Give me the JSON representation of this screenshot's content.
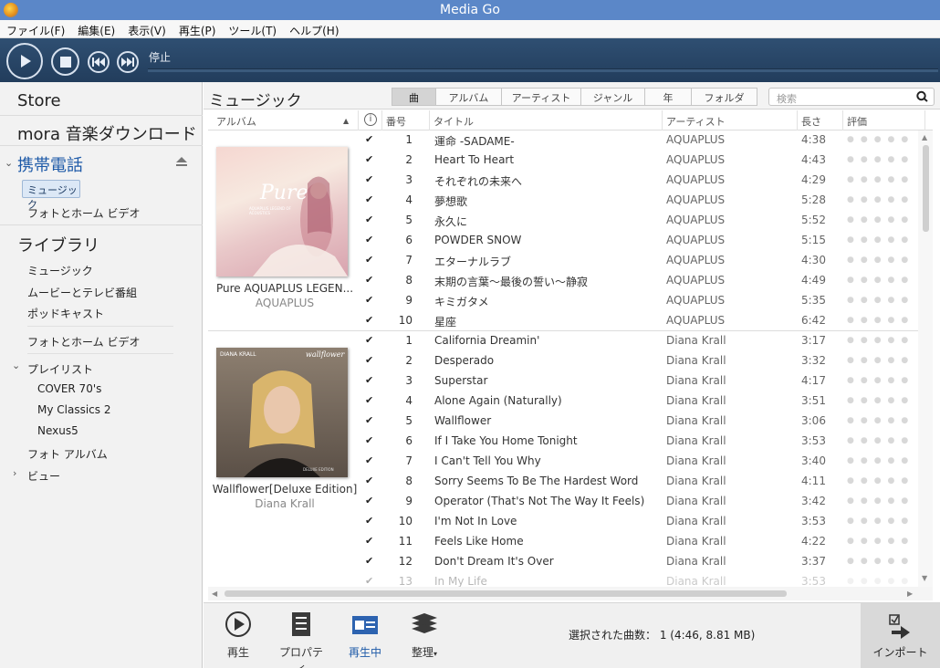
{
  "window": {
    "title": "Media Go"
  },
  "menu": [
    "ファイル(F)",
    "編集(E)",
    "表示(V)",
    "再生(P)",
    "ツール(T)",
    "ヘルプ(H)"
  ],
  "player": {
    "status": "停止"
  },
  "sidebar": {
    "store": "Store",
    "mora": "mora 音楽ダウンロード",
    "device": "携帯電話",
    "device_music": "ミュージック",
    "device_photo": "フォトとホーム ビデオ",
    "library": "ライブラリ",
    "lib_music": "ミュージック",
    "lib_movies": "ムービーとテレビ番組",
    "lib_podcast": "ポッドキャスト",
    "lib_photo": "フォトとホーム ビデオ",
    "playlist": "プレイリスト",
    "playlists": [
      "COVER 70's",
      "My Classics 2",
      "Nexus5"
    ],
    "photo_album": "フォト アルバム",
    "view": "ビュー"
  },
  "main": {
    "title": "ミュージック",
    "tabs": [
      "曲",
      "アルバム",
      "アーティスト",
      "ジャンル",
      "年",
      "フォルダ"
    ],
    "active_tab": "曲",
    "search_placeholder": "検索"
  },
  "columns": {
    "album": "アルバム",
    "info": "i",
    "num": "番号",
    "title": "タイトル",
    "artist": "アーティスト",
    "length": "長さ",
    "rating": "評価"
  },
  "albums": [
    {
      "name": "Pure AQUAPLUS LEGEN...",
      "artist": "AQUAPLUS",
      "art_title": "Pure",
      "art_sub": "AQUAPLUS LEGEND OF ACOUSTICS",
      "tracks": [
        {
          "n": "1",
          "title": "運命 -SADAME-",
          "artist": "AQUAPLUS",
          "len": "4:38"
        },
        {
          "n": "2",
          "title": "Heart To Heart",
          "artist": "AQUAPLUS",
          "len": "4:43"
        },
        {
          "n": "3",
          "title": "それぞれの未来へ",
          "artist": "AQUAPLUS",
          "len": "4:29"
        },
        {
          "n": "4",
          "title": "夢想歌",
          "artist": "AQUAPLUS",
          "len": "5:28"
        },
        {
          "n": "5",
          "title": "永久に",
          "artist": "AQUAPLUS",
          "len": "5:52"
        },
        {
          "n": "6",
          "title": "POWDER SNOW",
          "artist": "AQUAPLUS",
          "len": "5:15"
        },
        {
          "n": "7",
          "title": "エターナルラブ",
          "artist": "AQUAPLUS",
          "len": "4:30"
        },
        {
          "n": "8",
          "title": "末期の言葉～最後の誓い～静寂",
          "artist": "AQUAPLUS",
          "len": "4:49"
        },
        {
          "n": "9",
          "title": "キミガタメ",
          "artist": "AQUAPLUS",
          "len": "5:35"
        },
        {
          "n": "10",
          "title": "星座",
          "artist": "AQUAPLUS",
          "len": "6:42"
        }
      ]
    },
    {
      "name": "Wallflower[Deluxe Edition]",
      "artist": "Diana Krall",
      "art_title": "DIANA KRALL",
      "art_sub": "wallflower",
      "art_edition": "DELUXE EDITION",
      "tracks": [
        {
          "n": "1",
          "title": "California Dreamin'",
          "artist": "Diana Krall",
          "len": "3:17"
        },
        {
          "n": "2",
          "title": "Desperado",
          "artist": "Diana Krall",
          "len": "3:32"
        },
        {
          "n": "3",
          "title": "Superstar",
          "artist": "Diana Krall",
          "len": "4:17"
        },
        {
          "n": "4",
          "title": "Alone Again (Naturally)",
          "artist": "Diana Krall",
          "len": "3:51"
        },
        {
          "n": "5",
          "title": "Wallflower",
          "artist": "Diana Krall",
          "len": "3:06"
        },
        {
          "n": "6",
          "title": "If I Take You Home Tonight",
          "artist": "Diana Krall",
          "len": "3:53"
        },
        {
          "n": "7",
          "title": "I Can't Tell You Why",
          "artist": "Diana Krall",
          "len": "3:40"
        },
        {
          "n": "8",
          "title": "Sorry Seems To Be The Hardest Word",
          "artist": "Diana Krall",
          "len": "4:11"
        },
        {
          "n": "9",
          "title": "Operator (That's Not The Way It Feels)",
          "artist": "Diana Krall",
          "len": "3:42"
        },
        {
          "n": "10",
          "title": "I'm Not In Love",
          "artist": "Diana Krall",
          "len": "3:53"
        },
        {
          "n": "11",
          "title": "Feels Like Home",
          "artist": "Diana Krall",
          "len": "4:22"
        },
        {
          "n": "12",
          "title": "Don't Dream It's Over",
          "artist": "Diana Krall",
          "len": "3:37"
        },
        {
          "n": "13",
          "title": "In My Life",
          "artist": "Diana Krall",
          "len": "3:53"
        }
      ]
    }
  ],
  "bottom": {
    "play": "再生",
    "properties": "プロパティ",
    "now_playing": "再生中",
    "organize": "整理",
    "status": "選択された曲数： 1 (4:46, 8.81 MB)",
    "import": "インポート"
  },
  "colors": {
    "titlebar": "#5b87c8",
    "player": "#223d5c",
    "accent": "#1e5aa8"
  }
}
